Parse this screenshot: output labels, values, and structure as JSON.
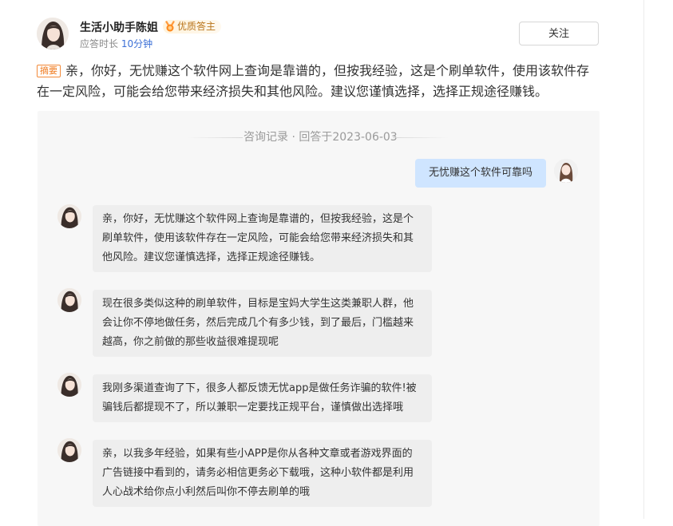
{
  "author": {
    "name": "生活小助手陈姐",
    "badge": "优质答主",
    "duration_label": "应答时长",
    "duration_value": "10分钟",
    "follow_label": "关注"
  },
  "summary": {
    "tag": "摘要",
    "text": "亲，你好，无忧赚这个软件网上查询是靠谱的，但按我经验，这是个刷单软件，使用该软件存在一定风险，可能会给您带来经济损失和其他风险。建议您谨慎选择，选择正规途径赚钱。"
  },
  "conversation": {
    "record_label": "咨询记录 · 回答于2023-06-03",
    "question": "无忧赚这个软件可靠吗",
    "answers": [
      "亲，你好，无忧赚这个软件网上查询是靠谱的，但按我经验，这是个刷单软件，使用该软件存在一定风险，可能会给您带来经济损失和其他风险。建议您谨慎选择，选择正规途径赚钱。",
      "现在很多类似这种的刷单软件，目标是宝妈大学生这类兼职人群，他会让你不停地做任务，然后完成几个有多少钱，到了最后，门槛越来越高，你之前做的那些收益很难提现呢",
      "我刚多渠道查询了下，很多人都反馈无忧app是做任务诈骗的软件!被骗钱后都提现不了，所以兼职一定要找正规平台，谨慎做出选择哦",
      "亲，以我多年经验，如果有些小APP是你从各种文章或者游戏界面的广告链接中看到的，请务必相信更务必下载哦，这种小软件都是利用人心战术给你点小利然后叫你不停去刷单的哦"
    ]
  },
  "colors": {
    "accent_blue": "#3b6fd6",
    "question_bubble": "#cfe5ff",
    "answer_bubble": "#eeeeee",
    "summary_tag": "#f07a1e",
    "badge_text": "#b8741a"
  }
}
